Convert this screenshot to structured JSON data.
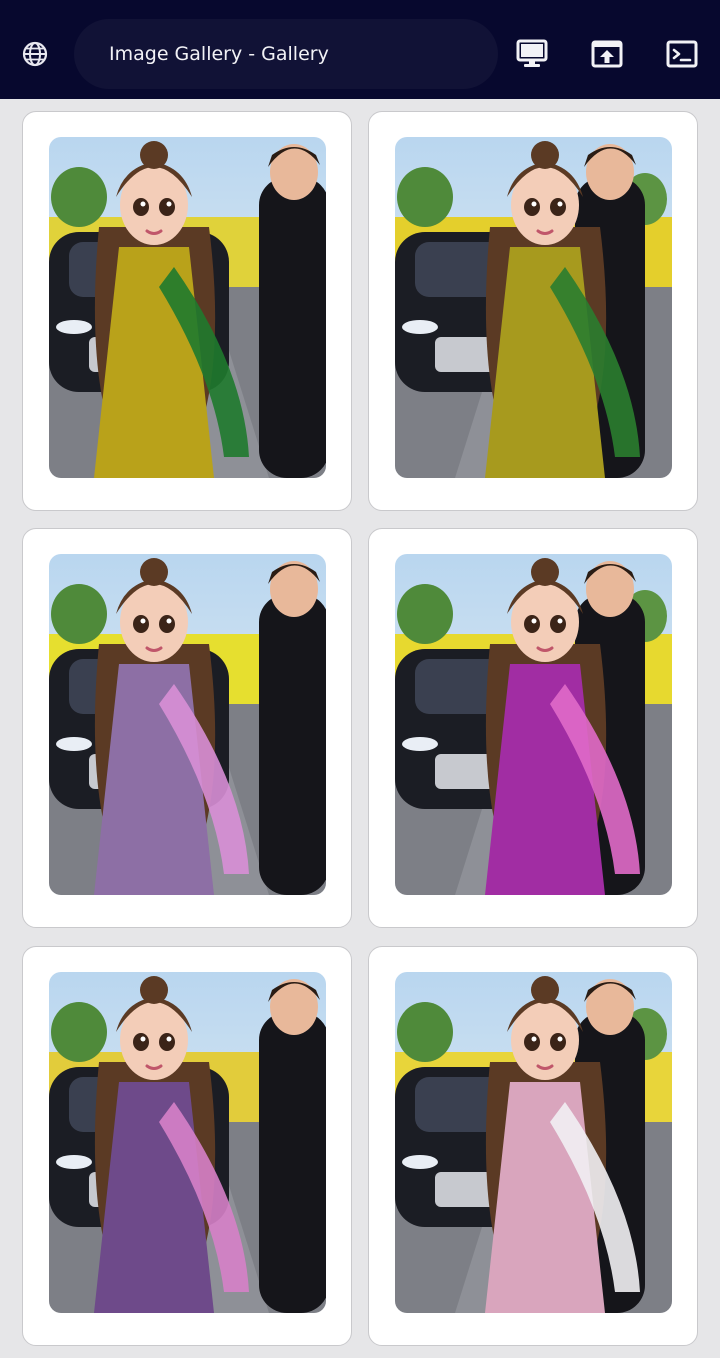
{
  "toolbar": {
    "url_title": "Image Gallery - Gallery",
    "status_fragment": ") ⁠ ⁠ ⁠ ⁠ ⁠ ⁠ ⁠ ⁠ ⁠ ⁠ ⁠ ⁠ ⁠ ⁠ ⁠ ⁠ ⁠ ⁠ ⁠ ⁠ ⁠ ⁠ ⁠ ⁠ ⁠ ⁠ ⁠ ⁠ ⁠ ⁠ ⁠ ⁠ ⁠ ⁠ ⁠ ⁠ ⁠ ⁠ )",
    "icons": [
      "globe-icon",
      "desktop-monitor-icon",
      "share-upload-icon",
      "terminal-icon"
    ]
  },
  "colors": {
    "toolbar_bg": "#07082e",
    "url_pill_bg": "#111236",
    "page_bg": "#e6e6e8",
    "card_bg": "#ffffff"
  },
  "gallery": {
    "items": [
      {
        "alt": "couple-yellow-dress-car",
        "dress": "#b9a21a",
        "accent": "#1f7a2e",
        "field": "#e0d23a"
      },
      {
        "alt": "couple-yellow-green-dress-car",
        "dress": "#a79a1e",
        "accent": "#2a7d2f",
        "field": "#e4cf2c"
      },
      {
        "alt": "couple-lilac-dress-car",
        "dress": "#8d6fa5",
        "accent": "#d88fd6",
        "field": "#e6df2f"
      },
      {
        "alt": "couple-magenta-dress-car",
        "dress": "#a12da3",
        "accent": "#e06ac9",
        "field": "#e7d92f"
      },
      {
        "alt": "couple-purple-floral-dress-car",
        "dress": "#6e4a8a",
        "accent": "#d681c8",
        "field": "#e2cc3b"
      },
      {
        "alt": "couple-pink-dress-white-suit",
        "dress": "#d9a5bd",
        "accent": "#f1f0f3",
        "field": "#e8d53a"
      }
    ]
  }
}
